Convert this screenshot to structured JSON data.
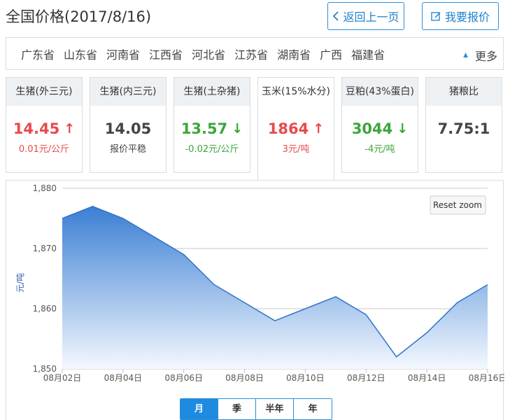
{
  "header": {
    "title": "全国价格(2017/8/16)",
    "back_label": "返回上一页",
    "quote_label": "我要报价"
  },
  "provinces": {
    "items": [
      "广东省",
      "山东省",
      "河南省",
      "江西省",
      "河北省",
      "江苏省",
      "湖南省",
      "广西",
      "福建省"
    ],
    "more_label": "更多"
  },
  "cards": [
    {
      "label": "生猪(外三元)",
      "value": "14.45",
      "arrow": "↑",
      "change": "0.01元/公斤",
      "trend": "up"
    },
    {
      "label": "生猪(内三元)",
      "value": "14.05",
      "arrow": "",
      "change": "报价平稳",
      "trend": "flat"
    },
    {
      "label": "生猪(土杂猪)",
      "value": "13.57",
      "arrow": "↓",
      "change": "-0.02元/公斤",
      "trend": "down"
    },
    {
      "label": "玉米(15%水分)",
      "value": "1864",
      "arrow": "↑",
      "change": "3元/吨",
      "trend": "up"
    },
    {
      "label": "豆粕(43%蛋白)",
      "value": "3044",
      "arrow": "↓",
      "change": "-4元/吨",
      "trend": "down"
    },
    {
      "label": "猪粮比",
      "value": "7.75:1",
      "arrow": "",
      "change": "",
      "trend": "flat"
    }
  ],
  "chart": {
    "reset_label": "Reset zoom"
  },
  "chart_data": {
    "type": "area",
    "ylabel": "元/吨",
    "ylim": [
      1850,
      1880
    ],
    "y_ticks": [
      1880,
      1870,
      1860,
      1850
    ],
    "y_tick_labels": [
      "1,880",
      "1,870",
      "1,860",
      "1,850"
    ],
    "x_tick_labels": [
      "08月02日",
      "08月04日",
      "08月06日",
      "08月08日",
      "08月10日",
      "08月12日",
      "08月14日",
      "08月16日"
    ],
    "grid": true,
    "x": [
      "08-02",
      "08-03",
      "08-04",
      "08-05",
      "08-06",
      "08-07",
      "08-08",
      "08-09",
      "08-10",
      "08-11",
      "08-12",
      "08-13",
      "08-14",
      "08-15",
      "08-16"
    ],
    "series": [
      {
        "values": [
          1875,
          1877,
          1875,
          1872,
          1869,
          1864,
          1861,
          1858,
          1860,
          1862,
          1859,
          1852,
          1856,
          1861,
          1864
        ]
      }
    ],
    "colors": {
      "fill_top": "#3b7fd4",
      "fill_bottom": "#f4f8fe",
      "line": "#2f74c8"
    }
  },
  "range_tabs": {
    "items": [
      "月",
      "季",
      "半年",
      "年"
    ],
    "active": "月"
  }
}
